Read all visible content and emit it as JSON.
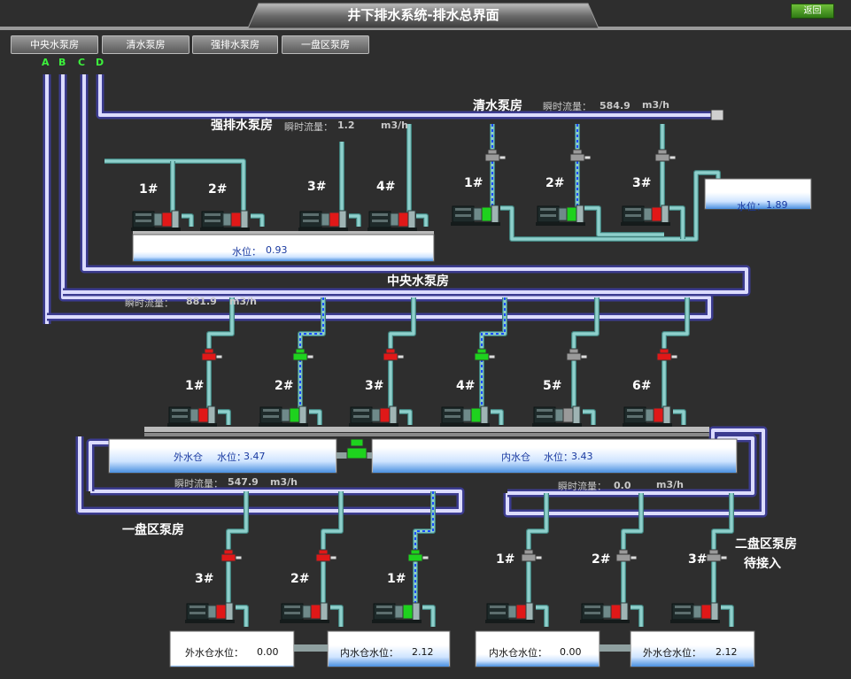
{
  "header": {
    "title": "井下排水系统-排水总界面",
    "back_label": "返回"
  },
  "tabs": [
    {
      "label": "中央水泵房"
    },
    {
      "label": "清水泵房"
    },
    {
      "label": "强排水泵房"
    },
    {
      "label": "一盘区泵房"
    }
  ],
  "pipes": {
    "labels": [
      "A",
      "B",
      "C",
      "D"
    ]
  },
  "flow_key": "瞬时流量：",
  "unit": "m3/h",
  "qingshui": {
    "title": "清水泵房",
    "flow_value": "584.9",
    "pumps": [
      "1#",
      "2#",
      "3#"
    ],
    "level_label": "水位：",
    "level_value": "1.89"
  },
  "qiangpai": {
    "title": "强排水泵房",
    "flow_value": "1.2",
    "pumps": [
      "1#",
      "2#",
      "3#",
      "4#"
    ],
    "level_label": "水位：",
    "level_value": "0.93"
  },
  "zhongyang": {
    "title": "中央水泵房",
    "flow_value": "881.9",
    "pumps": [
      "1#",
      "2#",
      "3#",
      "4#",
      "5#",
      "6#"
    ],
    "outer_label": "外水仓",
    "outer_level_label": "水位：",
    "outer_level_value": "3.47",
    "inner_label": "内水仓",
    "inner_level_label": "水位：",
    "inner_level_value": "3.43"
  },
  "pan1": {
    "title": "一盘区泵房",
    "flow_value": "547.9",
    "pumps": [
      "3#",
      "2#",
      "1#"
    ],
    "outer_label": "外水仓水位：",
    "outer_value": "0.00",
    "inner_label": "内水仓水位：",
    "inner_value": "2.12"
  },
  "pan2": {
    "title": "二盘区泵房",
    "subtitle": "待接入",
    "flow_value": "0.0",
    "pumps": [
      "1#",
      "2#",
      "3#"
    ],
    "inner_label": "内水仓水位：",
    "inner_value": "0.00",
    "outer_label": "外水仓水位：",
    "outer_value": "2.12"
  },
  "colors": {
    "running": "#1ed21e",
    "stopped": "#e01818",
    "idle": "#9a9a9a",
    "pipe": "#8ed0cc",
    "main_pipe": "#8a8ade",
    "water": "#4a90e0"
  }
}
